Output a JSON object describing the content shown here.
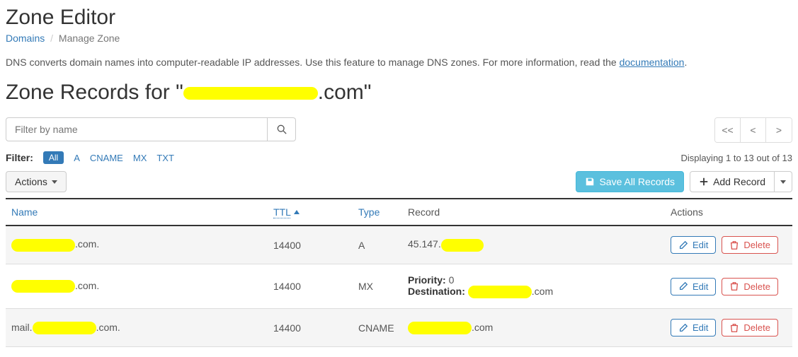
{
  "header": {
    "page_title": "Zone Editor",
    "breadcrumb": {
      "root": "Domains",
      "current": "Manage Zone"
    }
  },
  "intro": {
    "text": "DNS converts domain names into computer-readable IP addresses. Use this feature to manage DNS zones. For more information, read the ",
    "link_text": "documentation",
    "suffix": "."
  },
  "section": {
    "title_prefix": "Zone Records for \"",
    "domain_suffix": ".com",
    "title_suffix": "\""
  },
  "search": {
    "placeholder": "Filter by name"
  },
  "pager": {
    "first": "<<",
    "prev": "<",
    "next": ">"
  },
  "filter": {
    "label": "Filter:",
    "all": "All",
    "a": "A",
    "cname": "CNAME",
    "mx": "MX",
    "txt": "TXT"
  },
  "status": {
    "text": "Displaying 1 to 13 out of 13"
  },
  "buttons": {
    "actions": "Actions",
    "save_all": "Save All Records",
    "add_record": "Add Record",
    "edit": "Edit",
    "delete": "Delete"
  },
  "columns": {
    "name": "Name",
    "ttl": "TTL",
    "type": "Type",
    "record": "Record",
    "actions": "Actions"
  },
  "rows": [
    {
      "name_suffix": ".com.",
      "ttl": "14400",
      "type": "A",
      "record_plain_prefix": "45.147.",
      "record_plain_suffix": ""
    },
    {
      "name_suffix": ".com.",
      "ttl": "14400",
      "type": "MX",
      "record_priority_label": "Priority:",
      "record_priority_value": "0",
      "record_dest_label": "Destination:",
      "record_dest_suffix": ".com"
    },
    {
      "name_prefix": "mail.",
      "name_suffix": ".com.",
      "ttl": "14400",
      "type": "CNAME",
      "record_plain_prefix": "",
      "record_plain_suffix": ".com"
    }
  ]
}
